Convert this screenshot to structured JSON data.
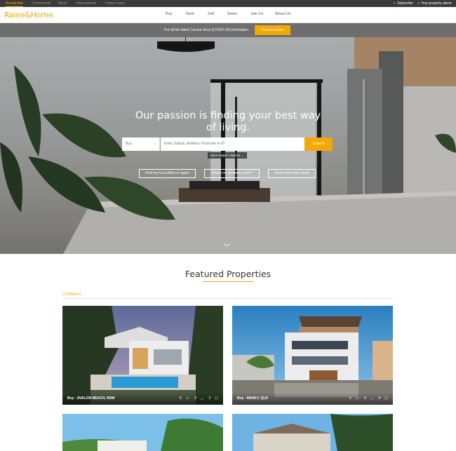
{
  "utility_bar": {
    "tabs": [
      "Residential",
      "Commercial",
      "Rural",
      "International",
      "Home Loans"
    ],
    "subscribe": "Subscribe",
    "alerts": "Your property alerts"
  },
  "header": {
    "logo": "Raine&Horne.",
    "nav": [
      "Buy",
      "Rent",
      "Sell",
      "News",
      "Join Us",
      "About Us"
    ]
  },
  "banner": {
    "text": "For all the latest Corona Virus (COVID-19) information",
    "button": "Find out more"
  },
  "hero": {
    "title_line1": "Our passion is finding your best way",
    "title_line2": "of living.",
    "select_value": "Buy",
    "search_placeholder": "Enter Suburb, Address, Postcode or ID",
    "search_button": "Search",
    "more_options": "More Search Options",
    "pills": [
      "Find my local office or agent",
      "What's my property worth?",
      "Great home loan deals"
    ]
  },
  "featured": {
    "title": "Featured Properties",
    "section_label": "CURRENT",
    "cards": [
      {
        "location": "Buy - AVALON BEACH, NSW",
        "beds": "6",
        "baths": "3",
        "cars": "2"
      },
      {
        "location": "Buy - MANLY, QLD",
        "beds": "5",
        "baths": "4",
        "cars": "4"
      }
    ]
  },
  "colors": {
    "accent": "#f2a900",
    "banner": "#6e6e6e",
    "utility": "#3a3a3a"
  }
}
